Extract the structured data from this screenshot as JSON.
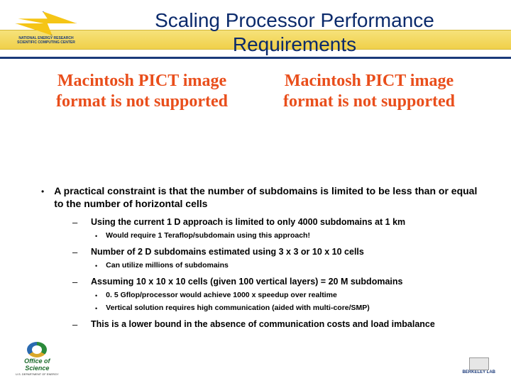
{
  "title": "Scaling Processor Performance Requirements",
  "pict_messages": [
    "Macintosh PICT image format is not supported",
    "Macintosh PICT image format is not supported"
  ],
  "main_bullet": "A practical constraint is that the number of subdomains is limited to be less than or equal to the number of horizontal cells",
  "subs": [
    {
      "text": "Using the current 1 D approach is limited to only 4000 subdomains at 1 km",
      "dots": [
        "Would require 1 Teraflop/subdomain using this approach!"
      ]
    },
    {
      "text": "Number of 2 D subdomains estimated using 3 x 3 or 10 x 10 cells",
      "dots": [
        "Can utilize millions of subdomains"
      ]
    },
    {
      "text": "Assuming 10 x 10 x 10 cells (given 100 vertical layers) = 20 M subdomains",
      "dots": [
        "0. 5 Gflop/processor would achieve 1000 x speedup over realtime",
        "Vertical solution requires high communication (aided with multi-core/SMP)"
      ]
    },
    {
      "text": "This is a lower bound in the absence of communication costs and load imbalance",
      "dots": []
    }
  ],
  "logos": {
    "nersc_caption": "NATIONAL ENERGY RESEARCH SCIENTIFIC COMPUTING CENTER",
    "office_line1": "Office of",
    "office_line2": "Science",
    "office_sub": "U.S. DEPARTMENT OF ENERGY",
    "berkeley": "BERKELEY LAB"
  }
}
